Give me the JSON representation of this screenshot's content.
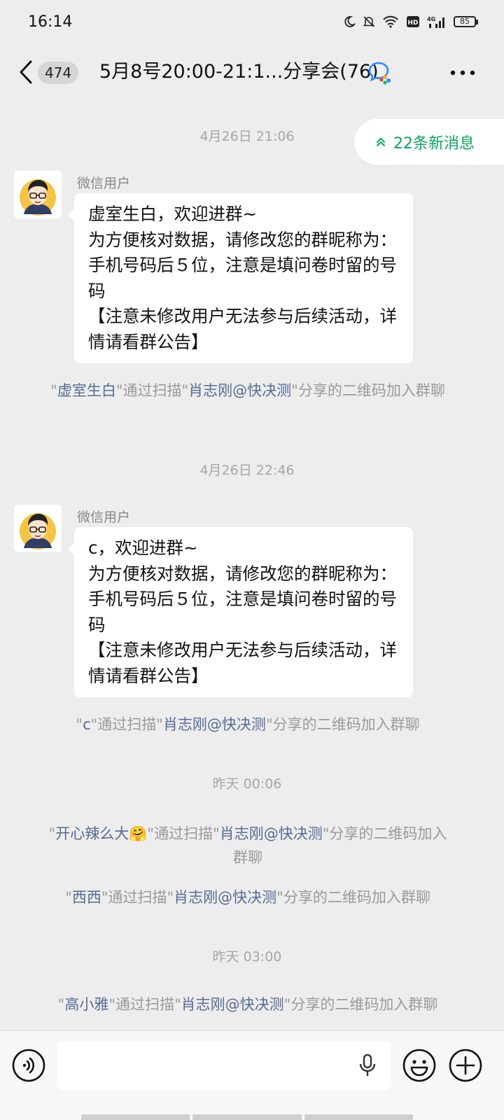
{
  "status_bar": {
    "time": "16:14",
    "battery": "85",
    "icons": [
      "moon-icon",
      "mute-icon",
      "wifi-icon",
      "hd-icon",
      "signal-4g-icon",
      "battery-icon"
    ]
  },
  "header": {
    "back_icon": "chevron-left-icon",
    "unread_count": "474",
    "title": "5月8号20:00-21:1...分享会(76)",
    "group_icon": "wecom-group-icon",
    "more_icon": "more-icon"
  },
  "new_messages": {
    "label": "22条新消息",
    "icon": "double-chevron-up-icon",
    "accent": "#07a55d"
  },
  "messages": [
    {
      "timestamp": "4月26日 21:06",
      "sender": "微信用户",
      "text": "虚室生白，欢迎进群~\n为方便核对数据，请修改您的群昵称为：手机号码后５位，注意是填问卷时留的号码\n【注意未修改用户无法参与后续活动，详情请看群公告】",
      "notice": {
        "q1": "\"",
        "user": "虚室生白",
        "mid": "\"通过扫描\"",
        "sharer": "肖志刚@快决测",
        "tail": "\"分享的二维码加入群聊"
      }
    },
    {
      "timestamp": "4月26日 22:46",
      "sender": "微信用户",
      "text": "c，欢迎进群~\n为方便核对数据，请修改您的群昵称为：手机号码后５位，注意是填问卷时留的号码\n【注意未修改用户无法参与后续活动，详情请看群公告】",
      "notice": {
        "q1": "\"",
        "user": "c",
        "mid": "\"通过扫描\"",
        "sharer": "肖志刚@快决测",
        "tail": "\"分享的二维码加入群聊"
      }
    }
  ],
  "system_groups": [
    {
      "timestamp": "昨天 00:06",
      "notices": [
        {
          "q1": "\"",
          "user": "开心辣么大🤗",
          "mid": "\"通过扫描\"",
          "sharer": "肖志刚@快决测",
          "tail": "\"分享的二维码加入群聊"
        },
        {
          "q1": "\"",
          "user": "西西",
          "mid": "\"通过扫描\"",
          "sharer": "肖志刚@快决测",
          "tail": "\"分享的二维码加入群聊"
        }
      ]
    },
    {
      "timestamp": "昨天 03:00",
      "notices": [
        {
          "q1": "\"",
          "user": "高小雅",
          "mid": "\"通过扫描\"",
          "sharer": "肖志刚@快决测",
          "tail": "\"分享的二维码加入群聊"
        }
      ]
    }
  ],
  "input_bar": {
    "placeholder": "",
    "voice_icon": "voice-icon",
    "mic_icon": "microphone-icon",
    "emoji_icon": "emoji-icon",
    "plus_icon": "plus-circle-icon"
  },
  "colors": {
    "background": "#ededed",
    "link_name": "#576b95",
    "system_text": "#9a9a9a",
    "bubble": "#ffffff"
  }
}
